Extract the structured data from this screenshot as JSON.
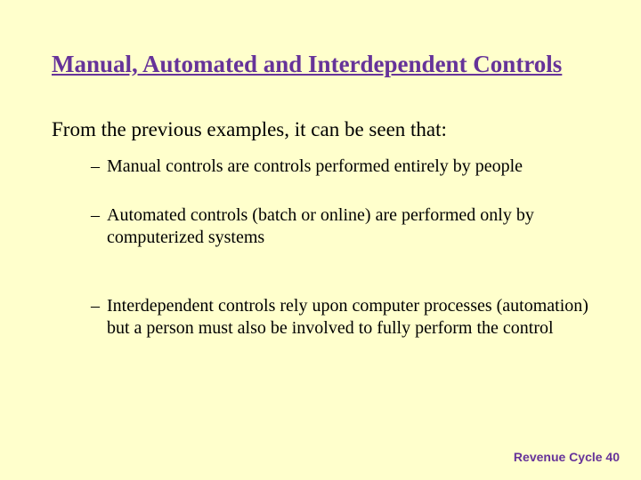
{
  "title": "Manual, Automated and Interdependent Controls",
  "intro": "From the previous examples, it can be seen that:",
  "bullets": [
    "Manual controls are controls performed entirely by people",
    "Automated controls (batch or online) are performed only by computerized systems",
    "Interdependent controls rely upon computer processes (automation) but a person must also be involved to fully perform the control"
  ],
  "footer": "Revenue Cycle 40"
}
